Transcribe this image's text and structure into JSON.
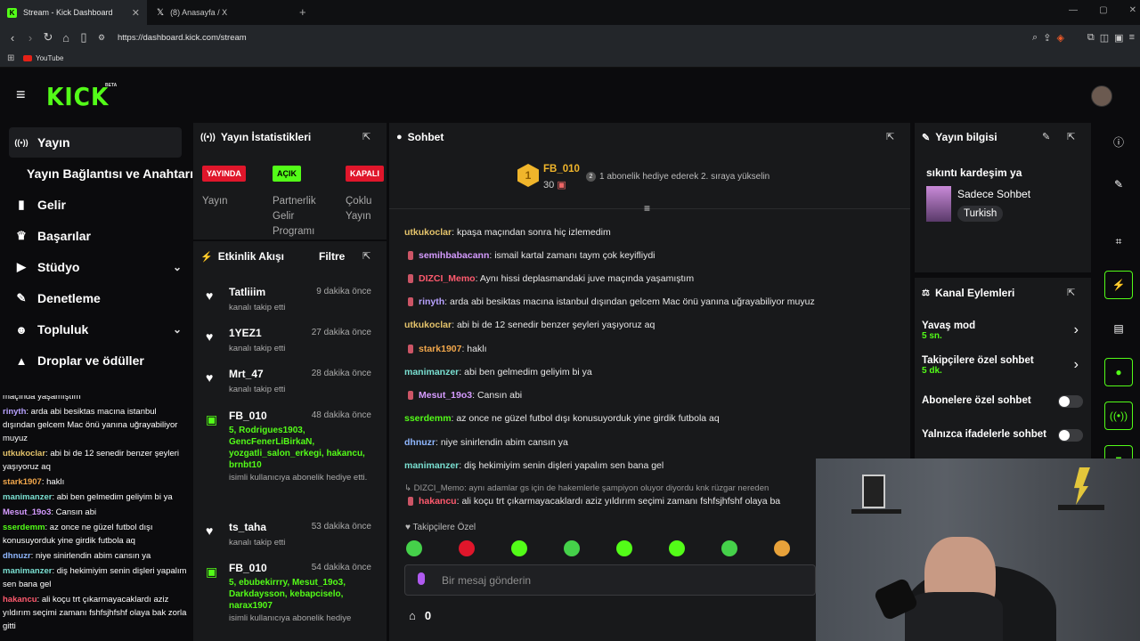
{
  "browser": {
    "tabs": [
      {
        "title": "Stream - Kick Dashboard"
      },
      {
        "title": "(8) Anasayfa / X"
      }
    ],
    "url": "https://dashboard.kick.com/stream",
    "bookmark": "YouTube"
  },
  "brand": {
    "logo": "KICK",
    "beta": "BETA"
  },
  "sidebar": {
    "items": [
      {
        "label": "Yayın",
        "icon": "broadcast-icon"
      },
      {
        "label": "Yayın Bağlantısı ve Anahtarı",
        "icon": ""
      },
      {
        "label": "Gelir",
        "icon": "chart-icon"
      },
      {
        "label": "Başarılar",
        "icon": "trophy-icon"
      },
      {
        "label": "Stüdyo",
        "icon": "studio-icon"
      },
      {
        "label": "Denetleme",
        "icon": "wrench-icon"
      },
      {
        "label": "Topluluk",
        "icon": "people-icon"
      },
      {
        "label": "Droplar ve ödüller",
        "icon": "drops-icon"
      }
    ]
  },
  "side_chat": [
    {
      "user": "",
      "text": "maçında yaşamıştım",
      "color": "#e8e8e8"
    },
    {
      "user": "rinyth",
      "text": ": arda abi besiktas macına istanbul dışından gelcem Mac önü yanına uğrayabiliyor muyuz",
      "color": "#b8a2ff"
    },
    {
      "user": "utkukoclar",
      "text": ": abi bi de 12 senedir benzer şeyleri yaşıyoruz aq",
      "color": "#e4c36b"
    },
    {
      "user": "stark1907",
      "text": ": haklı",
      "color": "#f0a64b"
    },
    {
      "user": "manimanzer",
      "text": ": abi ben gelmedim geliyim bi ya",
      "color": "#7ae0d2"
    },
    {
      "user": "Mesut_19o3",
      "text": ": Cansın abi",
      "color": "#d59bff"
    },
    {
      "user": "sserdemm",
      "text": ": az once ne güzel futbol dışı konusuyorduk yine girdik futbola aq",
      "color": "#53fc18"
    },
    {
      "user": "dhnuzr",
      "text": ": niye sinirlendin abim cansın ya",
      "color": "#8fb7ff"
    },
    {
      "user": "manimanzer",
      "text": ": diş hekimiyim senin dişleri yapalım sen bana gel",
      "color": "#7ae0d2"
    },
    {
      "user": "hakancu",
      "text": ": ali koçu trt çıkarmayacaklardı aziz yıldırım seçimi zamanı fshfsjhfshf olaya bak zorla gitti",
      "color": "#ff5a6e"
    }
  ],
  "stats": {
    "title": "Yayın İstatistikleri",
    "items": [
      {
        "badge": "YAYINDA",
        "label": "Yayın",
        "bg": "#e0162b",
        "fg": "#fff"
      },
      {
        "badge": "AÇIK",
        "label": "Partnerlik Gelir Programı",
        "bg": "#53fc18",
        "fg": "#000"
      },
      {
        "badge": "KAPALI",
        "label": "Çoklu Yayın",
        "bg": "#e0162b",
        "fg": "#fff"
      }
    ]
  },
  "activity": {
    "title": "Etkinlik Akışı",
    "filter": "Filtre",
    "items": [
      {
        "type": "follow",
        "name": "Tatliiim",
        "time": "9 dakika önce",
        "sub": "kanalı takip etti",
        "gift": ""
      },
      {
        "type": "follow",
        "name": "1YEZ1",
        "time": "27 dakika önce",
        "sub": "kanalı takip etti",
        "gift": ""
      },
      {
        "type": "follow",
        "name": "Mrt_47",
        "time": "28 dakika önce",
        "sub": "kanalı takip etti",
        "gift": ""
      },
      {
        "type": "gift",
        "name": "FB_010",
        "time": "48 dakika önce",
        "sub": "isimli kullanıcıya abonelik hediye etti.",
        "gift": "5, Rodrigues1903, GencFenerLiBirkaN, yozgatli_salon_erkegi, hakancu, brnbt10"
      },
      {
        "type": "follow",
        "name": "ts_taha",
        "time": "53 dakika önce",
        "sub": "kanalı takip etti",
        "gift": ""
      },
      {
        "type": "gift",
        "name": "FB_010",
        "time": "54 dakika önce",
        "sub": "isimli kullanıcıya abonelik hediye",
        "gift": "5, ebubekirrry, Mesut_19o3, Darkdaysson, kebapciselo, narax1907"
      }
    ]
  },
  "chat": {
    "title": "Sohbet",
    "leader": {
      "rank": "1",
      "name": "FB_010",
      "count": "30",
      "note": "1 abonelik hediye ederek 2. sıraya yükselin"
    },
    "messages": [
      {
        "user": "utkukoclar",
        "text": ": kpaşa maçından sonra hiç izlemedim",
        "color": "#e4c36b",
        "badge": false
      },
      {
        "user": "semihbabacann",
        "text": ": ismail kartal zamanı taym çok keyifliydi",
        "color": "#d59bff",
        "badge": true
      },
      {
        "user": "DIZCI_Memo",
        "text": ": Aynı hissi deplasmandaki juve maçında yaşamıştım",
        "color": "#ff5a6e",
        "badge": true
      },
      {
        "user": "rinyth",
        "text": ": arda abi besiktas macına istanbul dışından gelcem Mac önü yanına uğrayabiliyor muyuz",
        "color": "#b8a2ff",
        "badge": true
      },
      {
        "user": "utkukoclar",
        "text": ": abi bi de 12 senedir benzer şeyleri yaşıyoruz aq",
        "color": "#e4c36b",
        "badge": false
      },
      {
        "user": "stark1907",
        "text": ": haklı",
        "color": "#f0a64b",
        "badge": true
      },
      {
        "user": "manimanzer",
        "text": ": abi ben gelmedim geliyim bi ya",
        "color": "#7ae0d2",
        "badge": false
      },
      {
        "user": "Mesut_19o3",
        "text": ": Cansın abi",
        "color": "#d59bff",
        "badge": true
      },
      {
        "user": "sserdemm",
        "text": ": az once ne güzel futbol dışı konusuyorduk yine girdik futbola aq",
        "color": "#53fc18",
        "badge": false
      },
      {
        "user": "dhnuzr",
        "text": ": niye sinirlendin abim cansın ya",
        "color": "#8fb7ff",
        "badge": false
      },
      {
        "user": "manimanzer",
        "text": ": diş hekimiyim senin dişleri yapalım sen bana gel",
        "color": "#7ae0d2",
        "badge": false
      }
    ],
    "reply_ref": "DIZCI_Memo: aynı adamlar gs için de hakemlerle şampiyon oluyor diyordu knk rüzgar nereden",
    "reply": {
      "user": "hakancu",
      "text": ": ali koçu trt çıkarmayacaklardı aziz yıldırım seçimi zamanı fshfsjhfshf olaya ba",
      "color": "#ff5a6e"
    },
    "emote_label": "Takipçilere Özel",
    "emote_colors": [
      "#45d14a",
      "#e0162b",
      "#53fc18",
      "#45d14a",
      "#53fc18",
      "#53fc18",
      "#45d14a",
      "#e8a23a"
    ],
    "placeholder": "Bir mesaj gönderin",
    "points": "0"
  },
  "stream_info": {
    "title": "Yayın bilgisi",
    "stream_title": "sıkıntı kardeşim ya",
    "category": "Sadece Sohbet",
    "language": "Turkish"
  },
  "channel_actions": {
    "title": "Kanal Eylemleri",
    "slow": {
      "label": "Yavaş mod",
      "value": "5 sn."
    },
    "followers": {
      "label": "Takipçilere özel sohbet",
      "value": "5 dk."
    },
    "subs": {
      "label": "Abonelere özel sohbet"
    },
    "emotes": {
      "label": "Yalnızca ifadelerle sohbet"
    }
  }
}
